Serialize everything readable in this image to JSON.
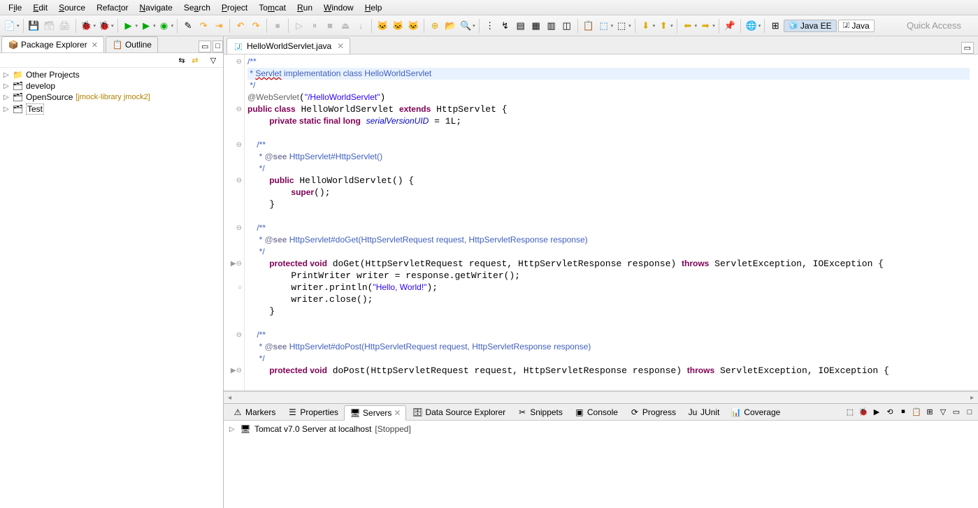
{
  "menu": {
    "items": [
      "File",
      "Edit",
      "Source",
      "Refactor",
      "Navigate",
      "Search",
      "Project",
      "Tomcat",
      "Run",
      "Window",
      "Help"
    ],
    "underlines": [
      "i",
      "E",
      "S",
      "",
      "N",
      "",
      "P",
      "",
      "R",
      "W",
      "H"
    ]
  },
  "quick_access_placeholder": "Quick Access",
  "perspective": {
    "javaee": "Java EE",
    "java": "Java"
  },
  "left": {
    "tab1": "Package Explorer",
    "tab2": "Outline",
    "tree": [
      {
        "label": "Other Projects",
        "icon": "📁"
      },
      {
        "label": "develop",
        "icon": "📁",
        "decorated": true
      },
      {
        "label": "OpenSource",
        "icon": "📁",
        "decorator": "[jmock-library jmock2]",
        "decorated": true
      },
      {
        "label": "Test",
        "icon": "📁",
        "decorated": true,
        "selected": true
      }
    ]
  },
  "editor": {
    "tab": "HelloWorldServlet.java",
    "code_lines": [
      {
        "t": "comment_open",
        "txt": "/**"
      },
      {
        "t": "comment_sel",
        "prefix": " * ",
        "err": "Servlet",
        "rest": " implementation class HelloWorldServlet"
      },
      {
        "t": "comment",
        "txt": " */"
      },
      {
        "t": "ann",
        "ann": "@WebServlet",
        "paren": "(",
        "str": "\"/HelloWorldServlet\"",
        "close": ")"
      },
      {
        "t": "classdecl",
        "p1": "public class",
        "name": " HelloWorldServlet ",
        "p2": "extends",
        "base": " HttpServlet {"
      },
      {
        "t": "field",
        "indent": "    ",
        "mods": "private static final long",
        "sp": " ",
        "fld": "serialVersionUID",
        "rest": " = 1L;"
      },
      {
        "t": "blank",
        "txt": ""
      },
      {
        "t": "comment",
        "txt": "    /**"
      },
      {
        "t": "seecomment",
        "indent": "     * ",
        "tag": "@see",
        "rest": " HttpServlet#HttpServlet()"
      },
      {
        "t": "comment",
        "txt": "     */"
      },
      {
        "t": "ctor",
        "indent": "    ",
        "mods": "public",
        "rest": " HelloWorldServlet() {"
      },
      {
        "t": "super",
        "indent": "        ",
        "kw": "super",
        "rest": "();"
      },
      {
        "t": "plain",
        "txt": "    }"
      },
      {
        "t": "blank",
        "txt": ""
      },
      {
        "t": "comment",
        "txt": "    /**"
      },
      {
        "t": "seecomment",
        "indent": "     * ",
        "tag": "@see",
        "rest": " HttpServlet#doGet(HttpServletRequest request, HttpServletResponse response)"
      },
      {
        "t": "comment",
        "txt": "     */"
      },
      {
        "t": "method",
        "indent": "    ",
        "mods": "protected void",
        "name": " doGet(HttpServletRequest request, HttpServletResponse response) ",
        "thr": "throws",
        "exc": " ServletException, IOException {"
      },
      {
        "t": "plain",
        "txt": "        PrintWriter writer = response.getWriter();"
      },
      {
        "t": "println",
        "indent": "        writer.println(",
        "str": "\"Hello, World!\"",
        "close": ");"
      },
      {
        "t": "plain",
        "txt": "        writer.close();"
      },
      {
        "t": "plain",
        "txt": "    }"
      },
      {
        "t": "blank",
        "txt": ""
      },
      {
        "t": "comment",
        "txt": "    /**"
      },
      {
        "t": "seecomment",
        "indent": "     * ",
        "tag": "@see",
        "rest": " HttpServlet#doPost(HttpServletRequest request, HttpServletResponse response)"
      },
      {
        "t": "comment",
        "txt": "     */"
      },
      {
        "t": "method_cut",
        "indent": "    ",
        "mods": "protected void",
        "name": " doPost(HttpServletRequest request, HttpServletResponse response) ",
        "thr": "throws",
        "exc": " ServletException, IOException {"
      }
    ],
    "gutter": [
      "⊖",
      "",
      "",
      "",
      "⊖",
      "",
      "",
      "⊖",
      "",
      "",
      "⊖",
      "",
      "",
      "",
      "⊖",
      "",
      "",
      "▶⊖",
      "",
      "○",
      "",
      "",
      "",
      "⊖",
      "",
      "",
      "▶⊖"
    ]
  },
  "bottom": {
    "tabs": [
      "Markers",
      "Properties",
      "Servers",
      "Data Source Explorer",
      "Snippets",
      "Console",
      "Progress",
      "JUnit",
      "Coverage"
    ],
    "active_idx": 2,
    "server_name": "Tomcat v7.0 Server at localhost",
    "server_state": "[Stopped]"
  }
}
